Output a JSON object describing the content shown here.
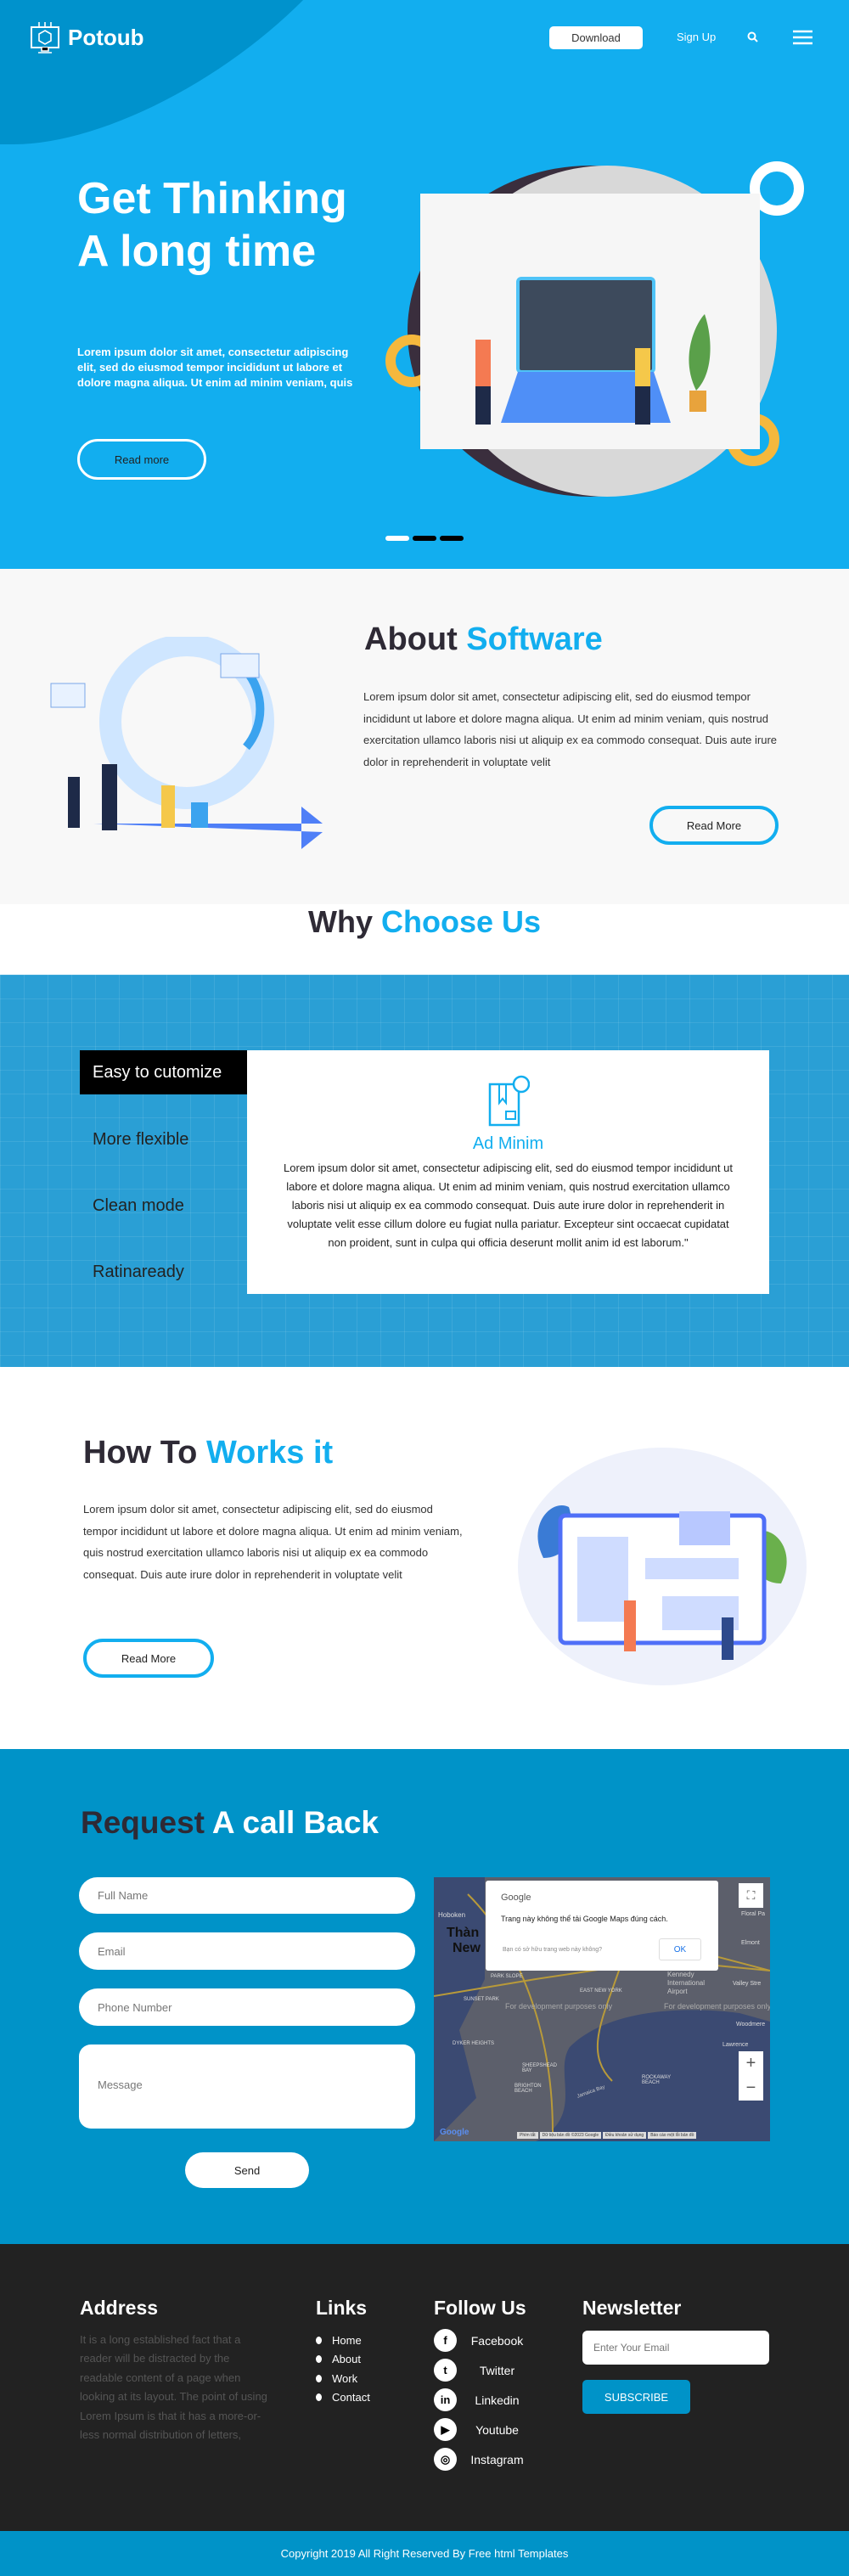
{
  "colors": {
    "primary": "#12aeef",
    "dark_blue": "#0093c8",
    "footer_bg": "#222222",
    "heading_dark": "#2e2a35"
  },
  "header": {
    "brand": "Potoub",
    "download_label": "Download",
    "signup_label": "Sign Up",
    "search_icon": "search-icon",
    "menu_icon": "hamburger-menu-icon"
  },
  "hero": {
    "title": "Get Thinking A long time",
    "text": "Lorem ipsum dolor sit amet, consectetur adipiscing elit, sed do eiusmod tempor incididunt ut labore et dolore magna aliqua. Ut enim ad minim veniam, quis",
    "button": "Read more",
    "slides": 3,
    "active_slide": 1
  },
  "about": {
    "title_a": "About",
    "title_b": "Software",
    "text": "Lorem ipsum dolor sit amet, consectetur adipiscing elit, sed do eiusmod tempor incididunt ut labore et dolore magna aliqua. Ut enim ad minim veniam, quis nostrud exercitation ullamco laboris nisi ut aliquip ex ea commodo consequat. Duis aute irure dolor in reprehenderit in voluptate velit",
    "button": "Read More"
  },
  "why": {
    "title_a": "Why",
    "title_b": "Choose Us"
  },
  "features": {
    "tabs": [
      "Easy to cutomize",
      "More flexible",
      "Clean mode",
      "Ratinaready"
    ],
    "active_tab": 0,
    "card": {
      "icon": "package-return-icon",
      "title": "Ad Minim",
      "text": "Lorem ipsum dolor sit amet, consectetur adipiscing elit, sed do eiusmod tempor incididunt ut labore et dolore magna aliqua. Ut enim ad minim veniam, quis nostrud exercitation ullamco laboris nisi ut aliquip ex ea commodo consequat. Duis aute irure dolor in reprehenderit in voluptate velit esse cillum dolore eu fugiat nulla pariatur. Excepteur sint occaecat cupidatat non proident, sunt in culpa qui officia deserunt mollit anim id est laborum.\""
    }
  },
  "how": {
    "title_a": "How To",
    "title_b": "Works it",
    "text": "Lorem ipsum dolor sit amet, consectetur adipiscing elit, sed do eiusmod tempor incididunt ut labore et dolore magna aliqua. Ut enim ad minim veniam, quis nostrud exercitation ullamco laboris nisi ut aliquip ex ea commodo consequat. Duis aute irure dolor in reprehenderit in voluptate velit",
    "button": "Read More"
  },
  "request": {
    "title_a": "Request",
    "title_b": "A call Back",
    "placeholders": {
      "name": "Full Name",
      "email": "Email",
      "phone": "Phone Number",
      "message": "Message"
    },
    "send": "Send"
  },
  "map": {
    "dialog_brand": "Google",
    "dialog_title": "Trang này không thể tải Google Maps đúng cách.",
    "dialog_question": "Bạn có sở hữu trang web này không?",
    "dialog_ok": "OK",
    "labels": [
      "Hoboken",
      "Thàn",
      "New",
      "Floral Pa",
      "Elmont",
      "PARK SLOPE",
      "EAST NEW YORK",
      "Kennedy International Airport",
      "Valley Stre",
      "SUNSET PARK",
      "Woodmere",
      "DYKER HEIGHTS",
      "Lawrence",
      "SHEEPSHEAD BAY",
      "BRIGHTON BEACH",
      "ROCKAWAY BEACH",
      "Jamaica Bay"
    ],
    "watermark": "For development purposes only",
    "footer": [
      "Phím tắt",
      "Dữ liệu bản đồ ©2023 Google",
      "Điều khoản sử dụng",
      "Báo cáo một lỗi bản đồ"
    ],
    "zoom_in": "+",
    "zoom_out": "−"
  },
  "footer": {
    "address_title": "Address",
    "address_text": "It is a long established fact that a reader will be distracted by the readable content of a page when looking at its layout. The point of using Lorem Ipsum is that it has a more-or-less normal distribution of letters,",
    "links_title": "Links",
    "links": [
      "Home",
      "About",
      "Work",
      "Contact"
    ],
    "follow_title": "Follow Us",
    "social": [
      {
        "label": "Facebook",
        "icon": "f"
      },
      {
        "label": "Twitter",
        "icon": "t"
      },
      {
        "label": "Linkedin",
        "icon": "in"
      },
      {
        "label": "Youtube",
        "icon": "▶"
      },
      {
        "label": "Instagram",
        "icon": "◎"
      }
    ],
    "newsletter_title": "Newsletter",
    "email_placeholder": "Enter Your Email",
    "subscribe": "SUBSCRIBE"
  },
  "copyright": "Copyright 2019 All Right Reserved By Free html Templates"
}
